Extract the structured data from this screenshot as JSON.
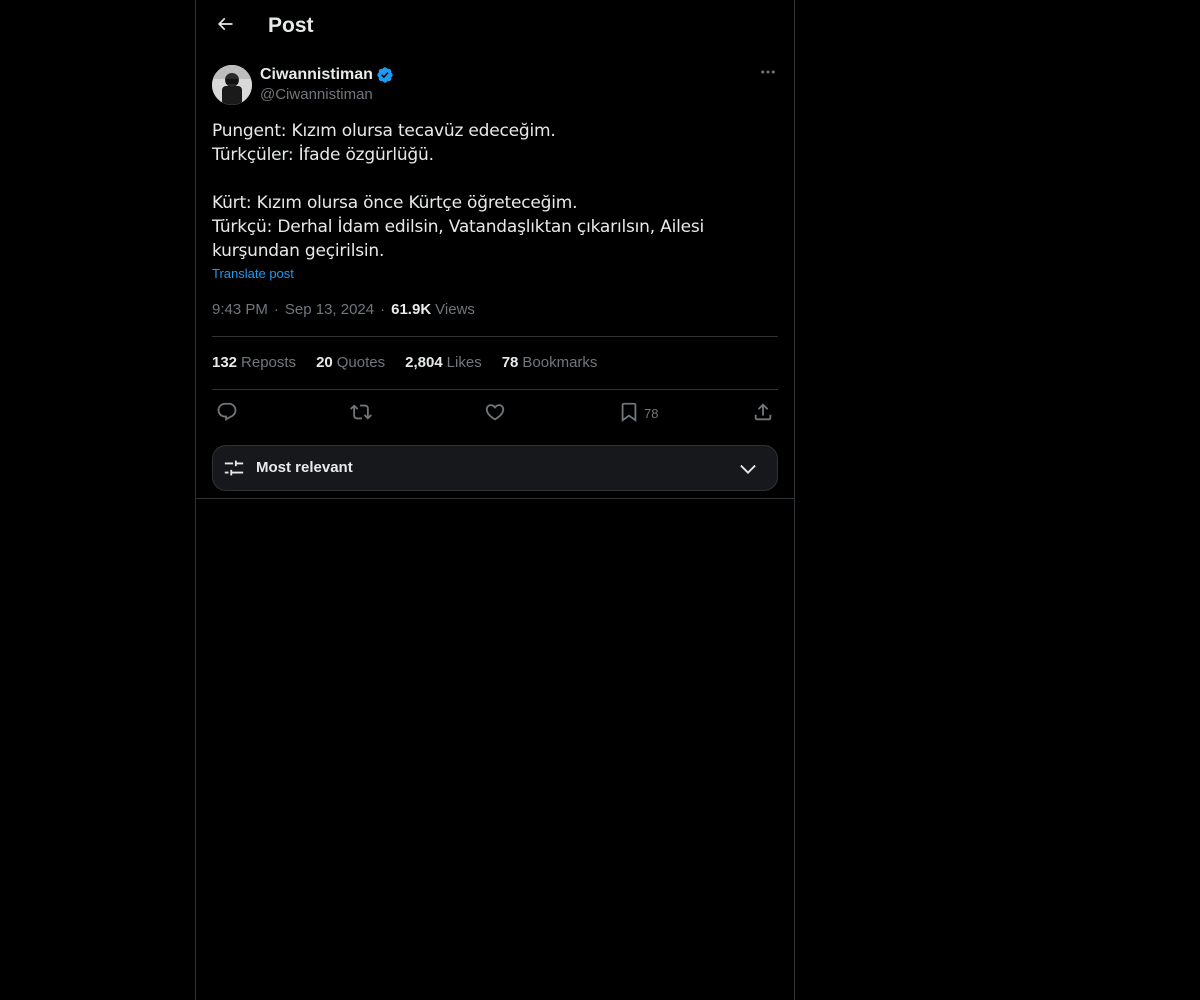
{
  "header": {
    "title": "Post",
    "back_icon": "arrow-left-icon"
  },
  "post": {
    "author": {
      "name": "Ciwannistiman",
      "handle": "@Ciwannistiman",
      "verified": true,
      "verified_color": "#1d9bf0"
    },
    "text": "Pungent: Kızım olursa tecavüz edeceğim.\nTürkçüler: İfade özgürlüğü.\n\nKürt: Kızım olursa önce Kürtçe öğreteceğim.\nTürkçü: Derhal İdam edilsin, Vatandaşlıktan çıkarılsın, Ailesi kurşundan geçirilsin.",
    "translate_label": "Translate post",
    "time": "9:43 PM",
    "date": "Sep 13, 2024",
    "views_count": "61.9K",
    "views_label": "Views",
    "separator": "·"
  },
  "stats": {
    "reposts_count": "132",
    "reposts_label": "Reposts",
    "quotes_count": "20",
    "quotes_label": "Quotes",
    "likes_count": "2,804",
    "likes_label": "Likes",
    "bookmarks_count": "78",
    "bookmarks_label": "Bookmarks"
  },
  "actions": {
    "reply_icon": "reply-icon",
    "repost_icon": "repost-icon",
    "like_icon": "heart-icon",
    "bookmark_icon": "bookmark-icon",
    "bookmark_count": "78",
    "share_icon": "share-icon"
  },
  "sort": {
    "label": "Most relevant",
    "icon": "sliders-icon",
    "chevron": "chevron-down-icon"
  },
  "colors": {
    "background": "#000000",
    "text_primary": "#e7e9ea",
    "text_secondary": "#71767b",
    "accent": "#1d9bf0",
    "border": "#2f3336"
  }
}
